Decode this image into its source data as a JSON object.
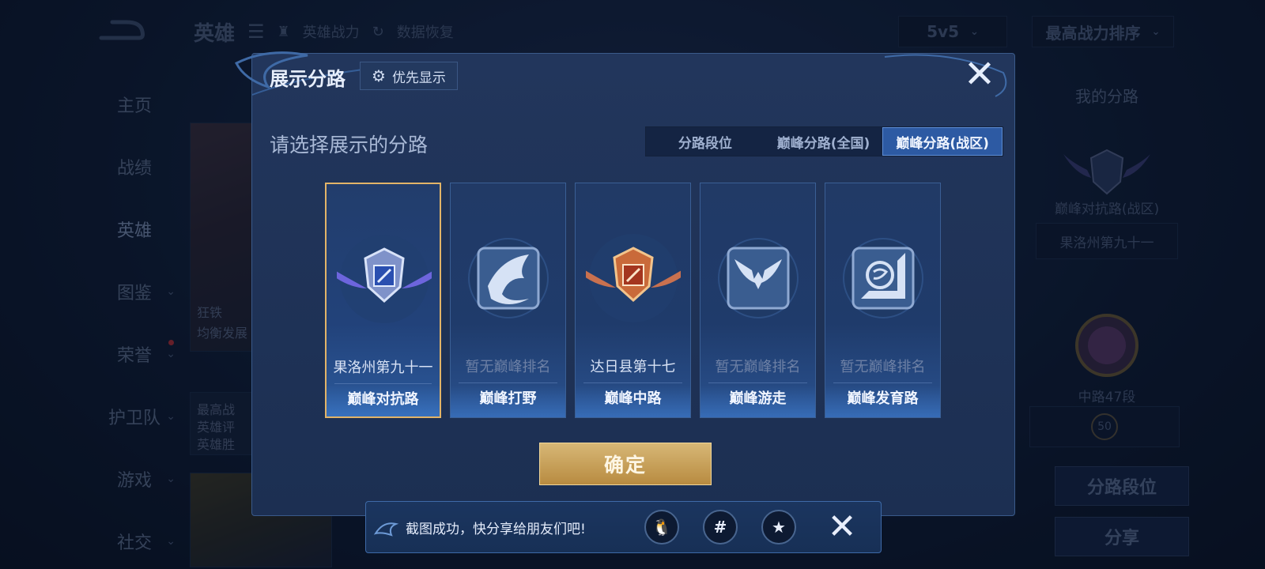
{
  "background": {
    "topbar": {
      "title": "英雄",
      "hero_power": "英雄战力",
      "data_restore": "数据恢复",
      "mode_select": "5v5",
      "sort_select": "最高战力排序"
    },
    "nav": [
      {
        "label": "主页"
      },
      {
        "label": "战绩"
      },
      {
        "label": "英雄"
      },
      {
        "label": "图鉴"
      },
      {
        "label": "荣誉"
      },
      {
        "label": "护卫队"
      },
      {
        "label": "游戏"
      },
      {
        "label": "社交"
      }
    ],
    "hero_card": {
      "line1": "狂铁",
      "line2": "均衡发展"
    },
    "info_card": {
      "line1": "最高战",
      "line2": "英雄评",
      "line3": "英雄胜"
    },
    "right_panel": {
      "title": "我的分路",
      "lane_label": "巅峰对抗路(战区)",
      "lane_rank": "果洛州第九十一",
      "rank_label": "中路47段",
      "level": "50",
      "btn_lane_rank": "分路段位",
      "btn_share": "分享"
    }
  },
  "modal": {
    "title": "展示分路",
    "priority_button": "优先显示",
    "prompt": "请选择展示的分路",
    "tabs": [
      {
        "label": "分路段位"
      },
      {
        "label": "巅峰分路(全国)"
      },
      {
        "label": "巅峰分路(战区)"
      }
    ],
    "active_tab": "巅峰分路(战区)",
    "lanes": [
      {
        "rank": "果洛州第九十一",
        "name": "巅峰对抗路",
        "icon": "shield-wings-blue-icon"
      },
      {
        "rank": "暂无巅峰排名",
        "name": "巅峰打野",
        "icon": "dragon-icon"
      },
      {
        "rank": "达日县第十七",
        "name": "巅峰中路",
        "icon": "shield-wings-orange-icon"
      },
      {
        "rank": "暂无巅峰排名",
        "name": "巅峰游走",
        "icon": "angel-wings-icon"
      },
      {
        "rank": "暂无巅峰排名",
        "name": "巅峰发育路",
        "icon": "archer-icon"
      }
    ],
    "selected_lane": "巅峰对抗路",
    "confirm": "确定"
  },
  "toast": {
    "message": "截图成功，快分享给朋友们吧!",
    "share_icons": [
      "qq-icon",
      "wechat-moments-icon",
      "qzone-icon"
    ]
  },
  "colors": {
    "modal_bg": "#1f3357",
    "accent_gold": "#d7b776",
    "tab_active": "#2d5aa3"
  }
}
